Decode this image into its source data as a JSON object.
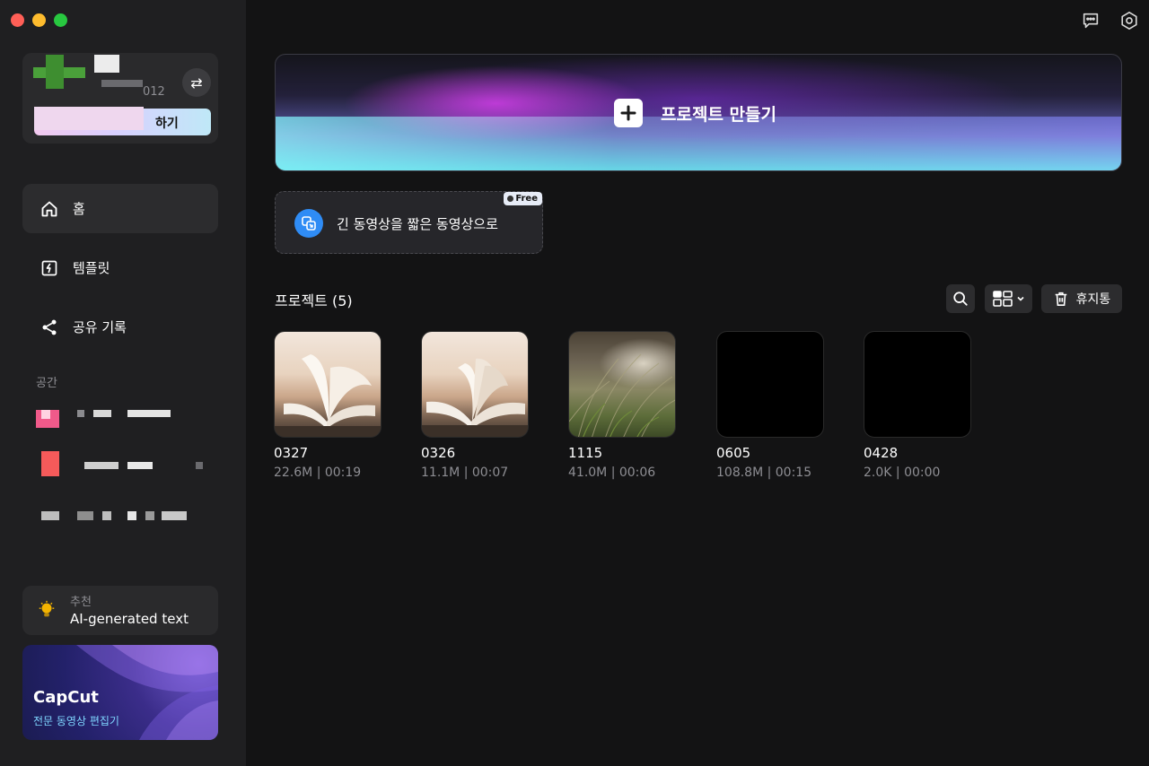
{
  "account": {
    "id_suffix": "012",
    "button_label": "하기"
  },
  "nav": {
    "home": "홈",
    "templates": "템플릿",
    "share_history": "공유 기록"
  },
  "spaces": {
    "label": "공간"
  },
  "promo": {
    "small": "추천",
    "title": "AI-generated text"
  },
  "capcut": {
    "title": "CapCut",
    "subtitle": "전문 동영상 편집기"
  },
  "main": {
    "create_label": "프로젝트 만들기",
    "long_to_short_label": "긴 동영상을 짧은 동영상으로",
    "free_badge": "Free",
    "projects_heading": "프로젝트  (5)",
    "trash_label": "휴지통"
  },
  "projects": [
    {
      "name": "0327",
      "meta": "22.6M | 00:19"
    },
    {
      "name": "0326",
      "meta": "11.1M | 00:07"
    },
    {
      "name": "1115",
      "meta": "41.0M | 00:06"
    },
    {
      "name": "0605",
      "meta": "108.8M | 00:15"
    },
    {
      "name": "0428",
      "meta": "2.0K | 00:00"
    }
  ],
  "colors": {
    "background": "#131314",
    "sidebar": "#1f1f21",
    "accent_blue": "#2f8cf5"
  }
}
